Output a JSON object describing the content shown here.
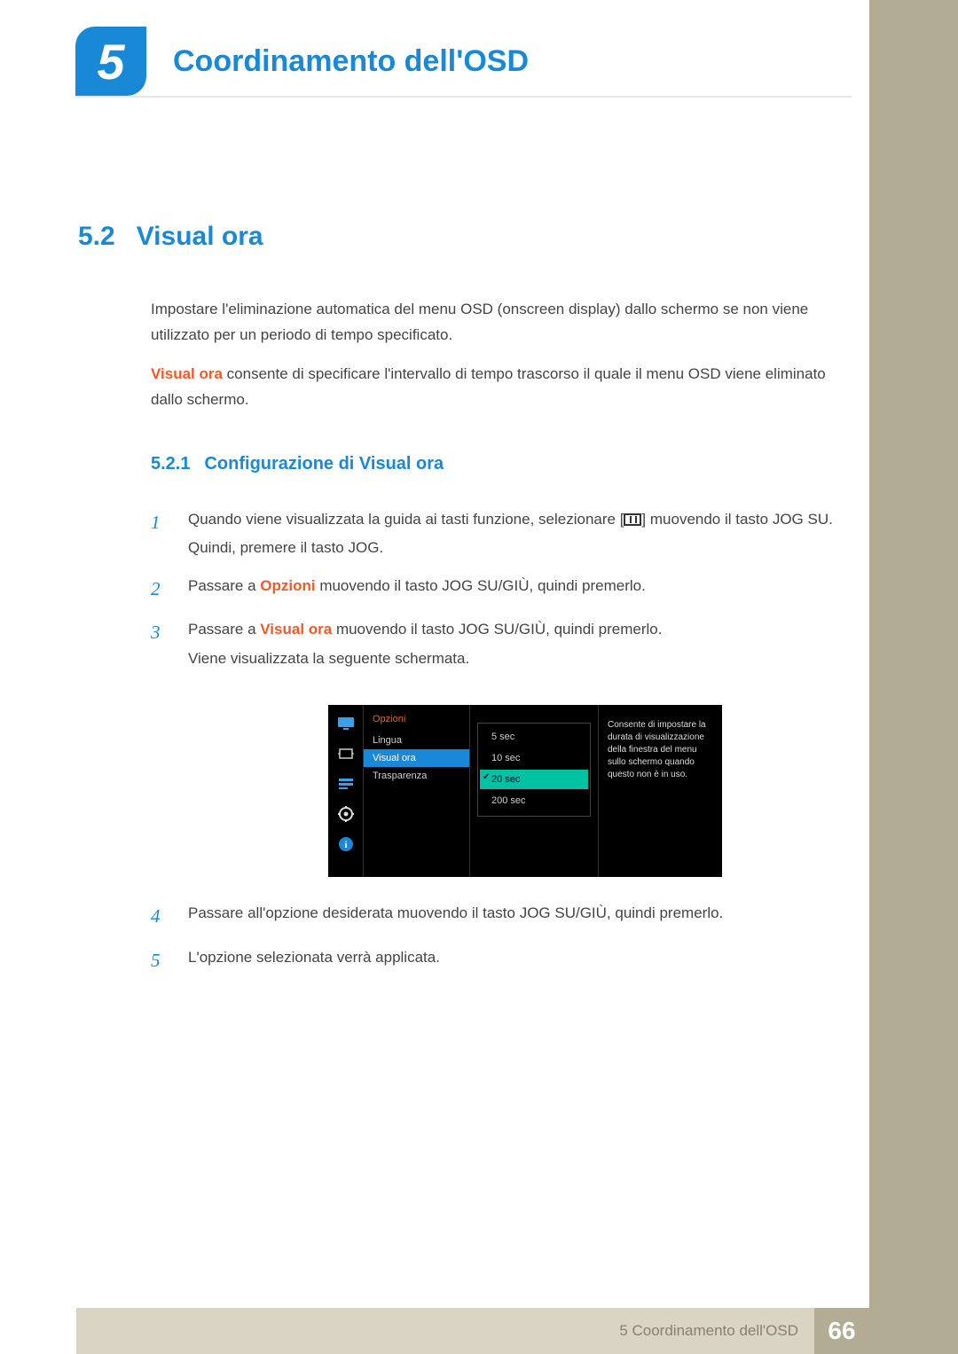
{
  "chapter": {
    "number": "5",
    "title": "Coordinamento dell'OSD"
  },
  "section": {
    "number": "5.2",
    "title": "Visual ora"
  },
  "intro1": "Impostare l'eliminazione automatica del menu OSD (onscreen display) dallo schermo se non viene utilizzato per un periodo di tempo specificato.",
  "intro2_hl": "Visual ora",
  "intro2_rest": " consente di specificare l'intervallo di tempo trascorso il quale il menu OSD viene eliminato dallo schermo.",
  "subsection": {
    "number": "5.2.1",
    "title": "Configurazione di Visual ora"
  },
  "steps": {
    "s1_a": "Quando viene visualizzata la guida ai tasti funzione, selezionare [",
    "s1_b": "] muovendo il tasto JOG SU. Quindi, premere il tasto JOG.",
    "s2_a": "Passare a ",
    "s2_hl": "Opzioni",
    "s2_b": " muovendo il tasto JOG SU/GIÙ, quindi premerlo.",
    "s3_a": "Passare a ",
    "s3_hl": "Visual ora",
    "s3_b": " muovendo il tasto JOG SU/GIÙ, quindi premerlo.",
    "s3_c": "Viene visualizzata la seguente schermata.",
    "s4": "Passare all'opzione desiderata muovendo il tasto JOG SU/GIÙ, quindi premerlo.",
    "s5": "L'opzione selezionata verrà applicata."
  },
  "osd": {
    "heading": "Opzioni",
    "menu": {
      "lingua": "Lingua",
      "visual_ora": "Visual ora",
      "trasparenza": "Trasparenza"
    },
    "options": {
      "o1": "5 sec",
      "o2": "10 sec",
      "o3": "20 sec",
      "o4": "200 sec"
    },
    "desc": "Consente di impostare la durata di visualizzazione della finestra del menu sullo schermo quando questo non è in uso."
  },
  "footer": {
    "label": "5 Coordinamento dell'OSD",
    "page": "66"
  }
}
